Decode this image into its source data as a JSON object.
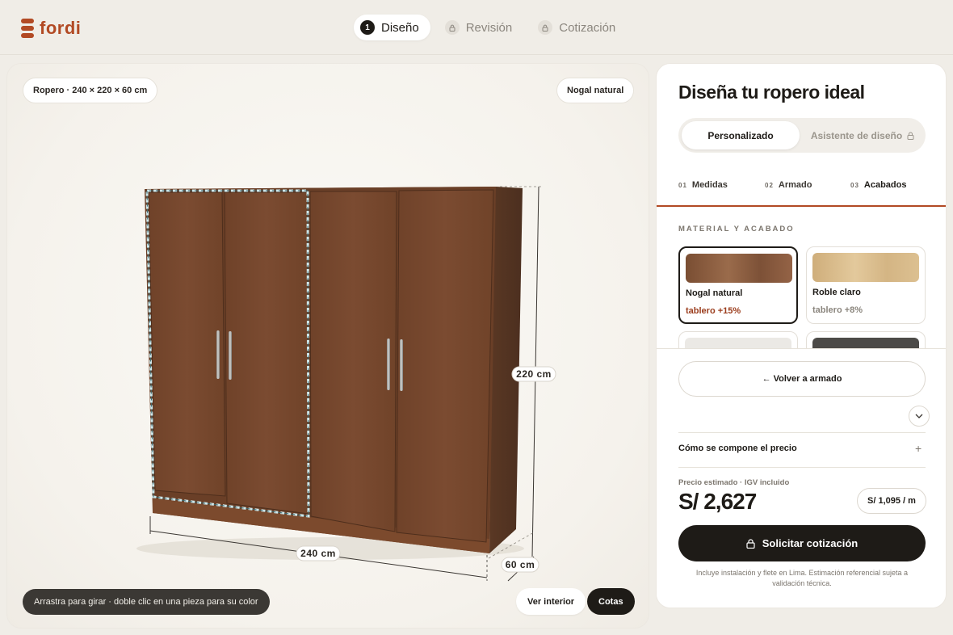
{
  "brand": {
    "name": "fordi",
    "color": "#b24a24"
  },
  "steps": [
    {
      "num": "1",
      "label": "Diseño",
      "state": "active"
    },
    {
      "label": "Revisión",
      "state": "locked"
    },
    {
      "label": "Cotización",
      "state": "locked"
    }
  ],
  "viewer": {
    "product_pill": "Ropero · 240 × 220 × 60 cm",
    "finish_pill": "Nogal natural",
    "hint": "Arrastra para girar · doble clic en una pieza para su color",
    "interior_button": "Ver interior",
    "dims_button": "Cotas",
    "dim_width": "240 cm",
    "dim_height": "220 cm",
    "dim_depth": "60 cm",
    "wood_color": "#7b4a30"
  },
  "panel": {
    "title": "Diseña tu ropero ideal",
    "mode_custom": "Personalizado",
    "mode_assistant": "Asistente de diseño",
    "tabs": [
      {
        "num": "01",
        "label": "Medidas"
      },
      {
        "num": "02",
        "label": "Armado"
      },
      {
        "num": "03",
        "label": "Acabados",
        "active": true
      }
    ],
    "section_label": "MATERIAL Y ACABADO",
    "materials": [
      {
        "name": "Nogal natural",
        "price": "tablero +15%",
        "color": "#8a5a3c",
        "selected": true
      },
      {
        "name": "Roble claro",
        "price": "tablero +8%",
        "color": "#d9bc8c"
      },
      {
        "name": "",
        "price": "",
        "color": "#ebe9e5"
      },
      {
        "name": "",
        "price": "",
        "color": "#4c4a47"
      }
    ],
    "back_button": "← Volver a armado",
    "compose_label": "Cómo se compone el precio",
    "price_caption": "Precio estimado · IGV incluido",
    "price": "S/ 2,627",
    "price_per_m": "S/ 1,095 / m",
    "cta": "Solicitar cotización",
    "note": "Incluye instalación y flete en Lima. Estimación referencial sujeta a validación técnica."
  }
}
